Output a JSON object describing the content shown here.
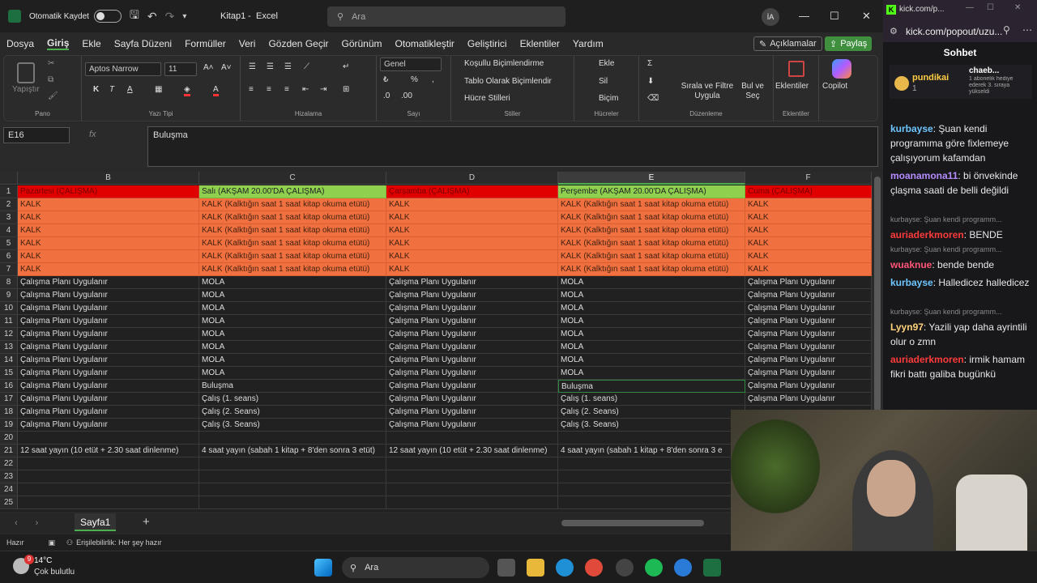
{
  "titlebar": {
    "autosave_label": "Otomatik Kaydet",
    "doc_title": "Kitap1",
    "app_name": "Excel",
    "title_sep": "-",
    "search_placeholder": "Ara",
    "user_initials": "İA"
  },
  "menu": {
    "tabs": [
      "Dosya",
      "Giriş",
      "Ekle",
      "Sayfa Düzeni",
      "Formüller",
      "Veri",
      "Gözden Geçir",
      "Görünüm",
      "Otomatikleştir",
      "Geliştirici",
      "Eklentiler",
      "Yardım"
    ],
    "active": "Giriş",
    "comments_label": "Açıklamalar",
    "share_label": "Paylaş"
  },
  "ribbon": {
    "clipboard": {
      "paste": "Yapıştır",
      "label": "Pano"
    },
    "font": {
      "name": "Aptos Narrow",
      "size": "11",
      "label": "Yazı Tipi",
      "bold": "K",
      "italic": "T",
      "underline": "A"
    },
    "alignment": {
      "label": "Hizalama"
    },
    "number": {
      "format": "Genel",
      "label": "Sayı"
    },
    "styles": {
      "conditional": "Koşullu Biçimlendirme",
      "table": "Tablo Olarak Biçimlendir",
      "cell": "Hücre Stilleri",
      "label": "Stiller"
    },
    "cells": {
      "insert": "Ekle",
      "delete": "Sil",
      "format": "Biçim",
      "label": "Hücreler"
    },
    "editing": {
      "sort": "Sırala ve Filtre Uygula",
      "find": "Bul ve Seç",
      "label": "Düzenleme"
    },
    "addins": {
      "label": "Eklentiler",
      "btn": "Eklentiler"
    },
    "copilot": "Copilot"
  },
  "formula": {
    "namebox": "E16",
    "fx": "fx",
    "content": "Buluşma"
  },
  "sheet": {
    "columns": [
      "B",
      "C",
      "D",
      "E",
      "F"
    ],
    "selected_col": "E",
    "rows": [
      [
        "Pazartesi (ÇALIŞMA)",
        "Salı (AKŞAM 20.00'DA ÇALIŞMA)",
        "Çarşamba (ÇALIŞMA)",
        "Perşembe (AKŞAM 20.00'DA ÇALIŞMA)",
        "Cuma (ÇALIŞMA)"
      ],
      [
        "KALK",
        "KALK (Kalktığın saat 1 saat kitap okuma etütü)",
        "KALK",
        "KALK (Kalktığın saat 1 saat kitap okuma etütü)",
        "KALK"
      ],
      [
        "KALK",
        "KALK (Kalktığın saat 1 saat kitap okuma etütü)",
        "KALK",
        "KALK (Kalktığın saat 1 saat kitap okuma etütü)",
        "KALK"
      ],
      [
        "KALK",
        "KALK (Kalktığın saat 1 saat kitap okuma etütü)",
        "KALK",
        "KALK (Kalktığın saat 1 saat kitap okuma etütü)",
        "KALK"
      ],
      [
        "KALK",
        "KALK (Kalktığın saat 1 saat kitap okuma etütü)",
        "KALK",
        "KALK (Kalktığın saat 1 saat kitap okuma etütü)",
        "KALK"
      ],
      [
        "KALK",
        "KALK (Kalktığın saat 1 saat kitap okuma etütü)",
        "KALK",
        "KALK (Kalktığın saat 1 saat kitap okuma etütü)",
        "KALK"
      ],
      [
        "KALK",
        "KALK (Kalktığın saat 1 saat kitap okuma etütü)",
        "KALK",
        "KALK (Kalktığın saat 1 saat kitap okuma etütü)",
        "KALK"
      ],
      [
        "Çalışma Planı Uygulanır",
        "MOLA",
        "Çalışma Planı Uygulanır",
        "MOLA",
        "Çalışma Planı Uygulanır"
      ],
      [
        "Çalışma Planı Uygulanır",
        "MOLA",
        "Çalışma Planı Uygulanır",
        "MOLA",
        "Çalışma Planı Uygulanır"
      ],
      [
        "Çalışma Planı Uygulanır",
        "MOLA",
        "Çalışma Planı Uygulanır",
        "MOLA",
        "Çalışma Planı Uygulanır"
      ],
      [
        "Çalışma Planı Uygulanır",
        "MOLA",
        "Çalışma Planı Uygulanır",
        "MOLA",
        "Çalışma Planı Uygulanır"
      ],
      [
        "Çalışma Planı Uygulanır",
        "MOLA",
        "Çalışma Planı Uygulanır",
        "MOLA",
        "Çalışma Planı Uygulanır"
      ],
      [
        "Çalışma Planı Uygulanır",
        "MOLA",
        "Çalışma Planı Uygulanır",
        "MOLA",
        "Çalışma Planı Uygulanır"
      ],
      [
        "Çalışma Planı Uygulanır",
        "MOLA",
        "Çalışma Planı Uygulanır",
        "MOLA",
        "Çalışma Planı Uygulanır"
      ],
      [
        "Çalışma Planı Uygulanır",
        "MOLA",
        "Çalışma Planı Uygulanır",
        "MOLA",
        "Çalışma Planı Uygulanır"
      ],
      [
        "Çalışma Planı Uygulanır",
        "Buluşma",
        "Çalışma Planı Uygulanır",
        "Buluşma",
        "Çalışma Planı Uygulanır"
      ],
      [
        "Çalışma Planı Uygulanır",
        "Çalış (1. seans)",
        "Çalışma Planı Uygulanır",
        "Çalış (1. seans)",
        "Çalışma Planı Uygulanır"
      ],
      [
        "Çalışma Planı Uygulanır",
        "Çalış (2. Seans)",
        "Çalışma Planı Uygulanır",
        "Çalış (2. Seans)",
        ""
      ],
      [
        "Çalışma Planı Uygulanır",
        "Çalış (3. Seans)",
        "Çalışma Planı Uygulanır",
        "Çalış (3. Seans)",
        ""
      ],
      [
        "",
        "",
        "",
        "",
        ""
      ],
      [
        "12 saat yayın (10 etüt + 2.30 saat dinlenme)",
        "4 saat yayın (sabah 1 kitap + 8'den sonra 3 etüt)",
        "12 saat yayın (10 etüt + 2.30 saat dinlenme)",
        "4 saat yayın (sabah 1 kitap + 8'den sonra 3 e",
        ""
      ],
      [
        "",
        "",
        "",
        "",
        ""
      ],
      [
        "",
        "",
        "",
        "",
        ""
      ],
      [
        "",
        "",
        "",
        "",
        ""
      ],
      [
        "",
        "",
        "",
        "",
        ""
      ]
    ],
    "row_numbers": [
      "1",
      "2",
      "3",
      "4",
      "5",
      "6",
      "7",
      "8",
      "9",
      "10",
      "11",
      "12",
      "13",
      "14",
      "15",
      "16",
      "17",
      "18",
      "19",
      "20",
      "21",
      "22",
      "23",
      "24",
      "25"
    ],
    "tab_name": "Sayfa1"
  },
  "status": {
    "ready": "Hazır",
    "accessibility": "Erişilebilirlik: Her şey hazır"
  },
  "taskbar": {
    "temp": "14°C",
    "weather": "Çok bulutlu",
    "search": "Ara",
    "badge": "9"
  },
  "browser": {
    "url_short": "kick.com/p...",
    "url": "kick.com/popout/uzu..."
  },
  "chat": {
    "title": "Sohbet",
    "pinned": {
      "user": "pundikai",
      "count": "1",
      "user2": "chaeb...",
      "note": "1 abonelik hediye ederek 3. sıraya yükseldi"
    },
    "messages": [
      {
        "user": "kurbayse",
        "color": "#6ec6ff",
        "text": "Şuan kendi programıma göre fixlemeye çalışıyorum kafamdan"
      },
      {
        "user": "moanamona11",
        "color": "#b58cff",
        "text": "bi önvekinde çlaşma saati de belli değildi"
      },
      {
        "reply": "kurbayse: Şuan kendi programm..."
      },
      {
        "user": "auriaderkmoren",
        "color": "#ff3b3b",
        "text": "BENDE"
      },
      {
        "reply": "kurbayse: Şuan kendi programm..."
      },
      {
        "user": "wuaknue",
        "color": "#ff5577",
        "text": "bende bende"
      },
      {
        "user": "kurbayse",
        "color": "#6ec6ff",
        "text": "Halledicez halledicez"
      },
      {
        "reply": "kurbayse: Şuan kendi programm..."
      },
      {
        "user": "Lyyn97",
        "color": "#ffd27a",
        "text": "Yazili yap daha ayrintili olur o zmn"
      },
      {
        "user": "auriaderkmoren",
        "color": "#ff3b3b",
        "text": "irmik hamam fikri battı galiba bugünkü"
      }
    ]
  }
}
